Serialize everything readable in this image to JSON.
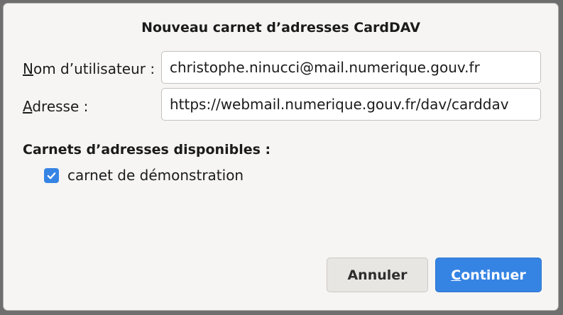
{
  "dialog": {
    "title": "Nouveau carnet d’adresses CardDAV"
  },
  "form": {
    "username_label_first": "N",
    "username_label_rest": "om d’utilisateur :",
    "username_value": "christophe.ninucci@mail.numerique.gouv.fr",
    "address_label_first": "A",
    "address_label_rest": "dresse :",
    "address_value": "https://webmail.numerique.gouv.fr/dav/carddav"
  },
  "books": {
    "heading": "Carnets d’adresses disponibles :",
    "items": [
      {
        "label": "carnet de démonstration",
        "checked": true
      }
    ]
  },
  "buttons": {
    "cancel_label": "Annuler",
    "continue_first": "C",
    "continue_rest": "ontinuer"
  },
  "colors": {
    "accent": "#3584e4",
    "background": "#f6f5f4"
  }
}
